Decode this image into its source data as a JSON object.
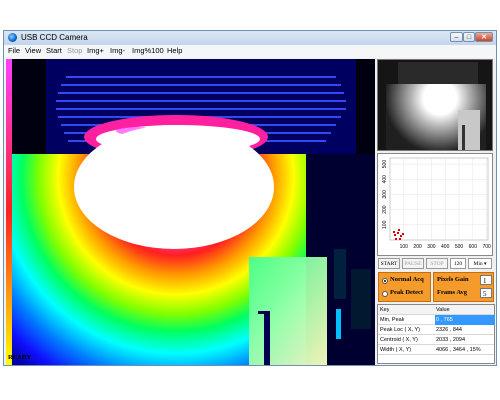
{
  "window": {
    "title": "USB CCD Camera"
  },
  "menu": [
    {
      "label": "File",
      "enabled": true
    },
    {
      "label": "View",
      "enabled": true
    },
    {
      "label": "Start",
      "enabled": true
    },
    {
      "label": "Stop",
      "enabled": false
    },
    {
      "label": "Img+",
      "enabled": true
    },
    {
      "label": "Img-",
      "enabled": true
    },
    {
      "label": "Img%100",
      "enabled": true
    },
    {
      "label": "Help",
      "enabled": true
    }
  ],
  "chart": {
    "x_ticks": [
      "100",
      "200",
      "300",
      "400",
      "500",
      "600",
      "700"
    ],
    "y_ticks": [
      "100",
      "200",
      "300",
      "400",
      "500"
    ]
  },
  "controls": {
    "start": "START",
    "pause": "PAUSE",
    "stop": "STOP",
    "count": "120",
    "mode": "Min"
  },
  "acquisition": {
    "normal_label": "Normal Acq",
    "peak_label": "Peak Detect",
    "gain_label": "Pixels Gain",
    "gain_value": "1",
    "avg_label": "Frams Avg",
    "avg_value": "5"
  },
  "table": {
    "headers": [
      "Key",
      "Value"
    ],
    "rows": [
      [
        "Min, Peak",
        "0 , 765"
      ],
      [
        "Peak Loc ( X, Y)",
        "2326 , 844"
      ],
      [
        "Centroid ( X, Y)",
        "2033 , 2094"
      ],
      [
        "Width ( X, Y)",
        "4066 , 3464 , 15%"
      ]
    ]
  },
  "status": "READY",
  "colors": {
    "accent": "#f59b2c",
    "selection": "#3399ff",
    "marker": "#e00000"
  }
}
